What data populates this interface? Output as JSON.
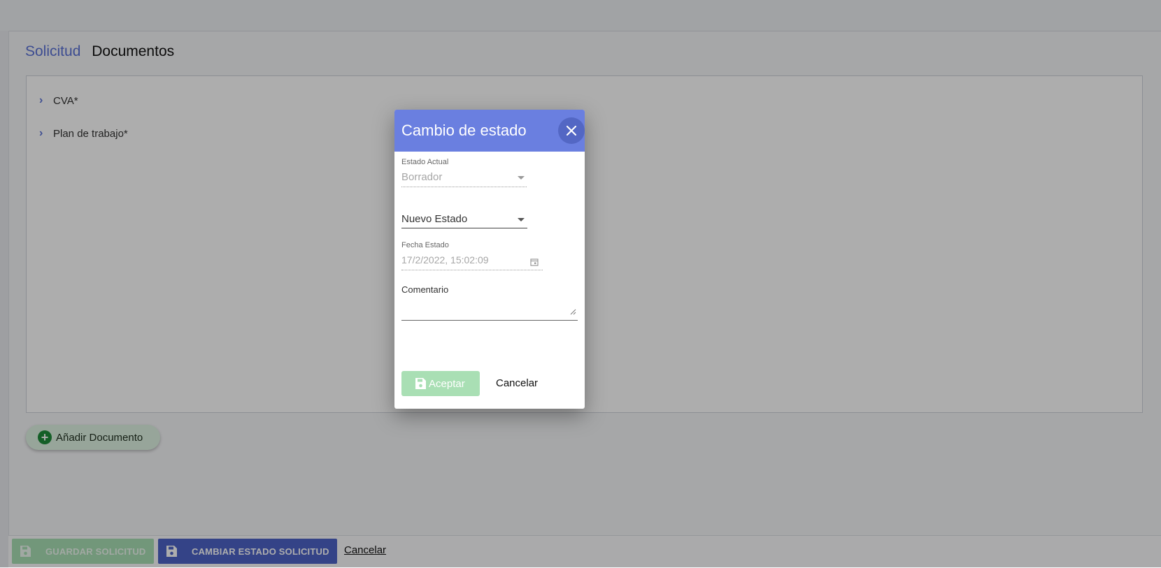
{
  "page": {
    "crumb": "Solicitud",
    "title": "Documentos"
  },
  "documents": [
    {
      "label": "CVA*"
    },
    {
      "label": "Plan de trabajo*"
    }
  ],
  "add_document_label": "Añadir Documento",
  "footer": {
    "save_label": "GUARDAR SOLICITUD",
    "change_state_label": "CAMBIAR ESTADO SOLICITUD",
    "cancel_label": "Cancelar"
  },
  "dialog": {
    "title": "Cambio de estado",
    "estado_actual": {
      "label": "Estado Actual",
      "value": "Borrador"
    },
    "nuevo_estado": {
      "placeholder": "Nuevo Estado"
    },
    "fecha_estado": {
      "label": "Fecha Estado",
      "value": "17/2/2022, 15:02:09"
    },
    "comentario": {
      "label": "Comentario",
      "value": ""
    },
    "accept_label": "Aceptar",
    "cancel_label": "Cancelar"
  },
  "colors": {
    "primary": "#6a7fe0",
    "primary_dark": "#4d63c8",
    "success_light": "#a9dfb4",
    "success": "#1e8c3a"
  }
}
